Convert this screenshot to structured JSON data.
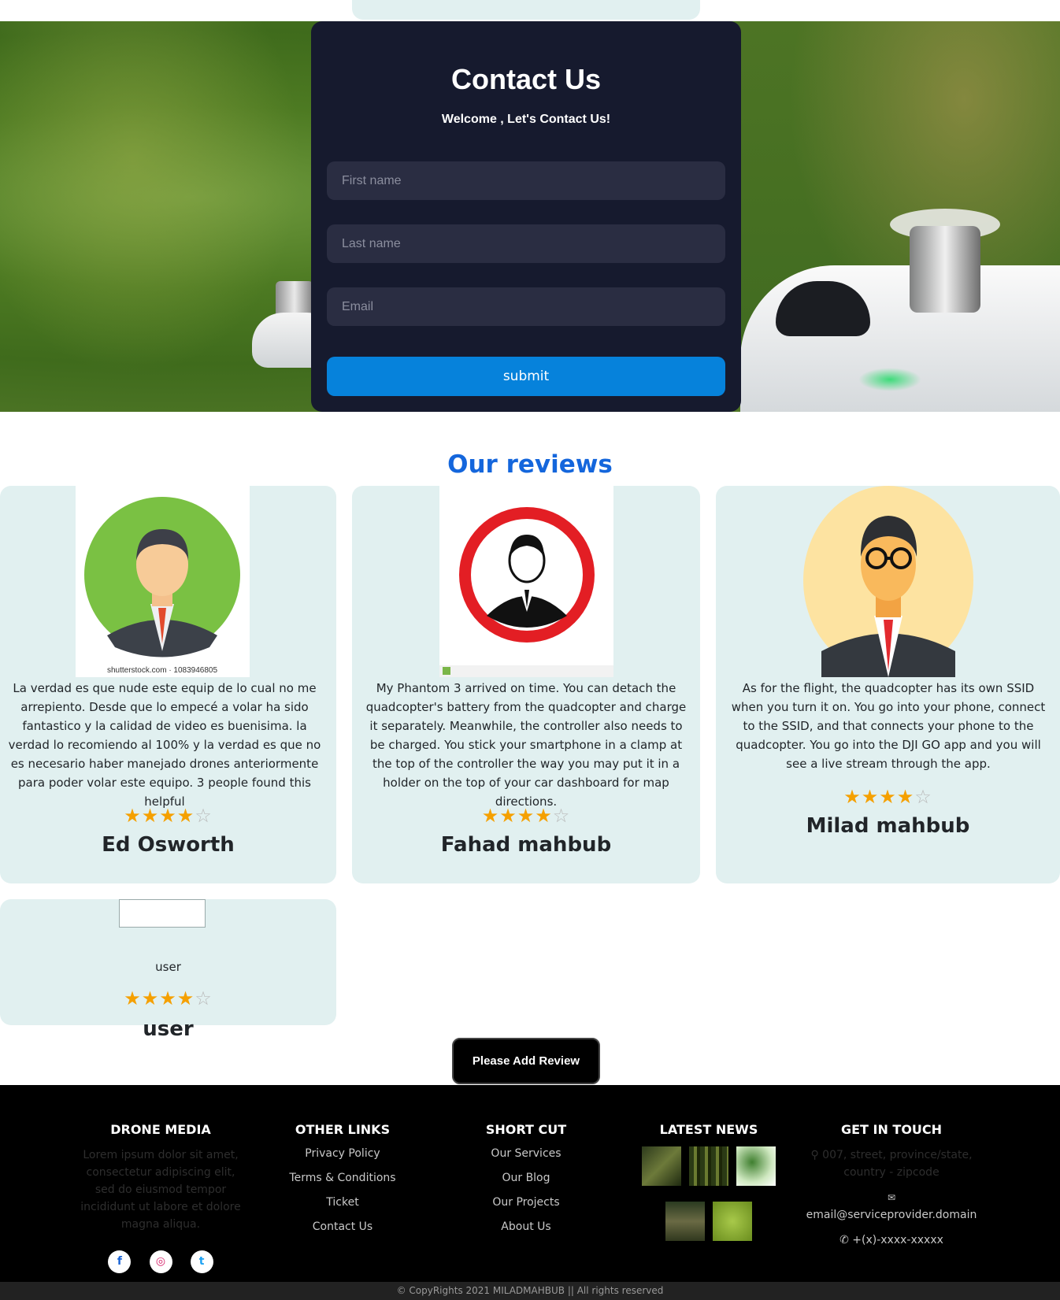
{
  "contact": {
    "title": "Contact Us",
    "subtitle": "Welcome , Let's Contact Us!",
    "first_name_placeholder": "First name",
    "last_name_placeholder": "Last name",
    "email_placeholder": "Email",
    "submit_label": "submit"
  },
  "reviews": {
    "title": "Our reviews",
    "items": [
      {
        "text": "La verdad es que nude este equip de lo cual no me arrepiento. Desde que lo empecé a volar ha sido fantastico y la calidad de video es buenisima. la verdad lo recomiendo al 100% y la verdad es que no es necesario haber manejado drones anteriormente para poder volar este equipo. 3 people found this helpful",
        "rating": 4.5,
        "name": "Ed Osworth",
        "image_caption": "shutterstock.com · 1083946805"
      },
      {
        "text": "My Phantom 3 arrived on time. You can detach the quadcopter's battery from the quadcopter and charge it separately. Meanwhile, the controller also needs to be charged. You stick your smartphone in a clamp at the top of the controller the way you may put it in a holder on the top of your car dashboard for map directions.",
        "rating": 4.5,
        "name": "Fahad mahbub"
      },
      {
        "text": "As for the flight, the quadcopter has its own SSID when you turn it on. You go into your phone, connect to the SSID, and that connects your phone to the quadcopter. You go into the DJI GO app and you will see a live stream through the app.",
        "rating": 4.5,
        "name": "Milad mahbub"
      },
      {
        "text": "user",
        "rating": 4.5,
        "name": "user"
      }
    ],
    "stars_full": "★★★★",
    "stars_half": "☆",
    "add_review_label": "Please Add Review"
  },
  "footer": {
    "col1": {
      "title": "DRONE MEDIA",
      "text": "Lorem ipsum dolor sit amet, consectetur adipiscing elit, sed do eiusmod tempor incididunt ut labore et dolore magna aliqua."
    },
    "col2": {
      "title": "OTHER LINKS",
      "links": [
        "Privacy Policy",
        "Terms & Conditions",
        "Ticket",
        "Contact Us"
      ]
    },
    "col3": {
      "title": "SHORT CUT",
      "links": [
        "Our Services",
        "Our Blog",
        "Our Projects",
        "About Us"
      ]
    },
    "col4": {
      "title": "LATEST NEWS"
    },
    "col5": {
      "title": "GET IN TOUCH",
      "address": "007, street, province/state, country - zipcode",
      "email": "email@serviceprovider.domain",
      "phone": "+(x)-xxxx-xxxxx"
    },
    "social": {
      "facebook": "f",
      "instagram": "◎",
      "twitter": "t"
    },
    "copyright": "© CopyRights 2021 MILADMAHBUB || All rights reserved"
  },
  "colors": {
    "accent": "#0682db",
    "reviews_title": "#1466dc",
    "card_bg": "#e1f0f0",
    "form_bg": "#161a2e",
    "star": "#f5a000"
  }
}
